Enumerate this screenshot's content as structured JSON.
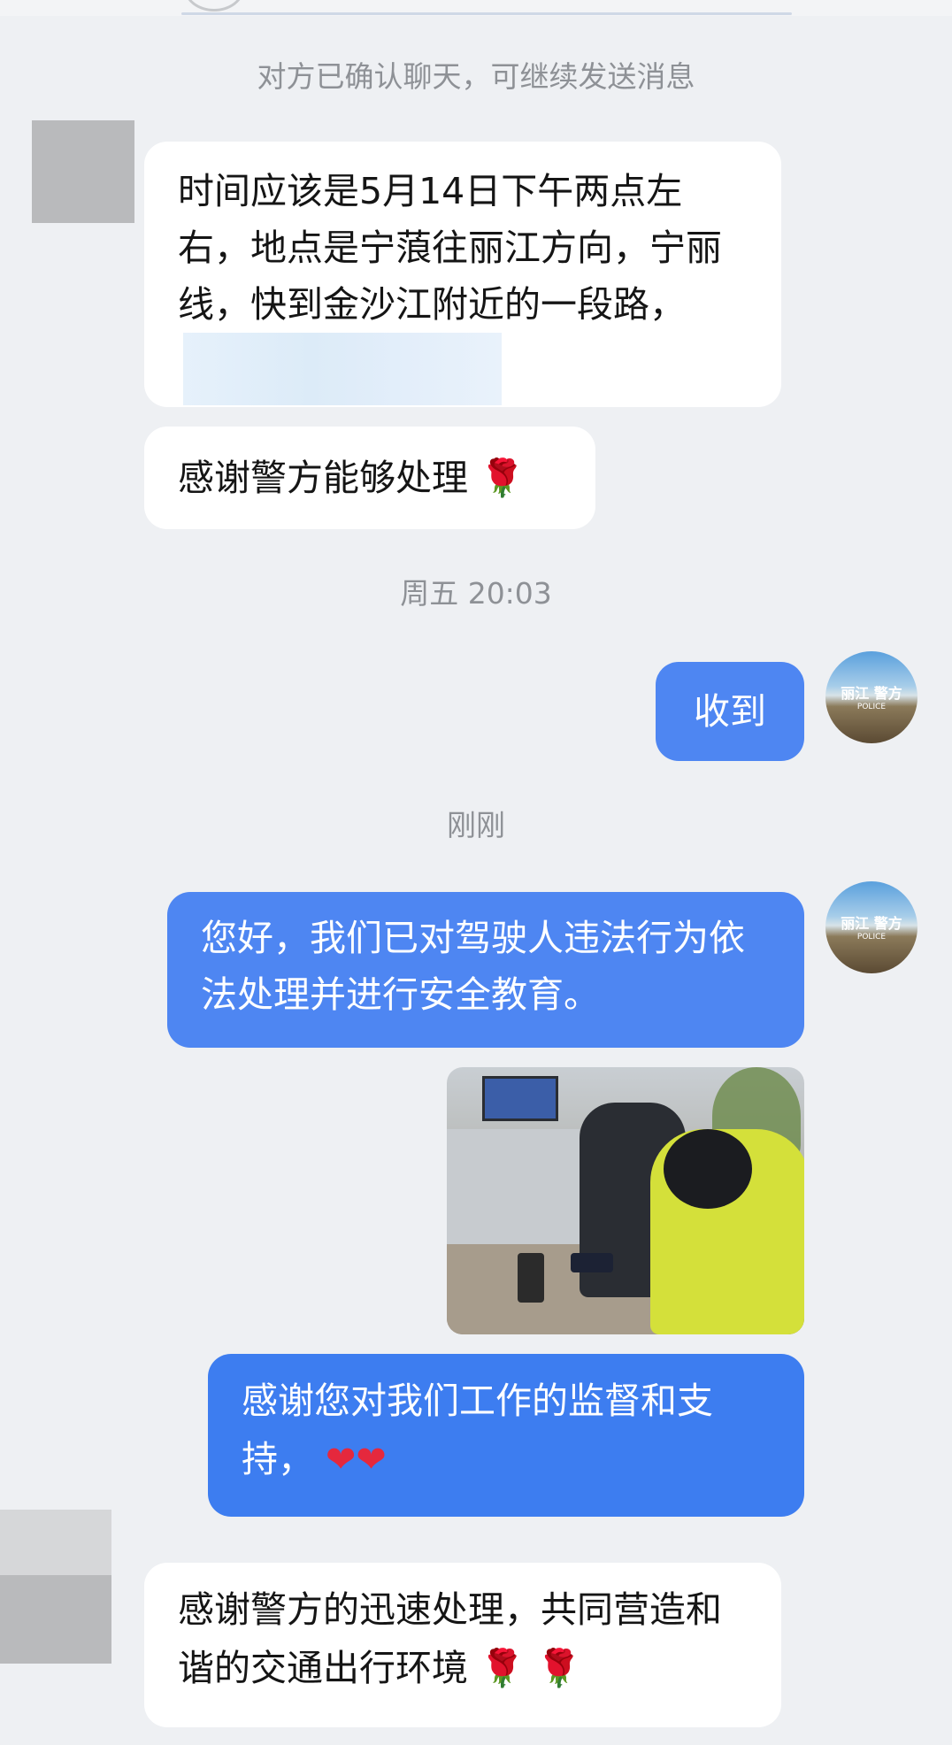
{
  "system": {
    "confirmed_notice": "对方已确认聊天，可继续发送消息",
    "time_friday": "周五 20:03",
    "time_just_now": "刚刚"
  },
  "messages": {
    "m1_text": "时间应该是5月14日下午两点左右，地点是宁蒗往丽江方向，宁丽线，快到金沙江附近的一段路，",
    "m2_text": "感谢警方能够处理",
    "m3_text": "收到",
    "m4_text": "您好，我们已对驾驶人违法行为依法处理并进行安全教育。",
    "m5_text": "感谢您对我们工作的监督和支持，",
    "m6_text": "感谢警方的迅速处理，共同营造和谐的交通出行环境"
  },
  "police_avatar": {
    "label": "丽江 警方",
    "sub": "POLICE"
  },
  "icons": {
    "rose": "rose-emoji",
    "heart": "red-heart-emoji"
  },
  "colors": {
    "background": "#eef0f3",
    "incoming_bubble": "#ffffff",
    "outgoing_bubble": "#4e86f2"
  }
}
